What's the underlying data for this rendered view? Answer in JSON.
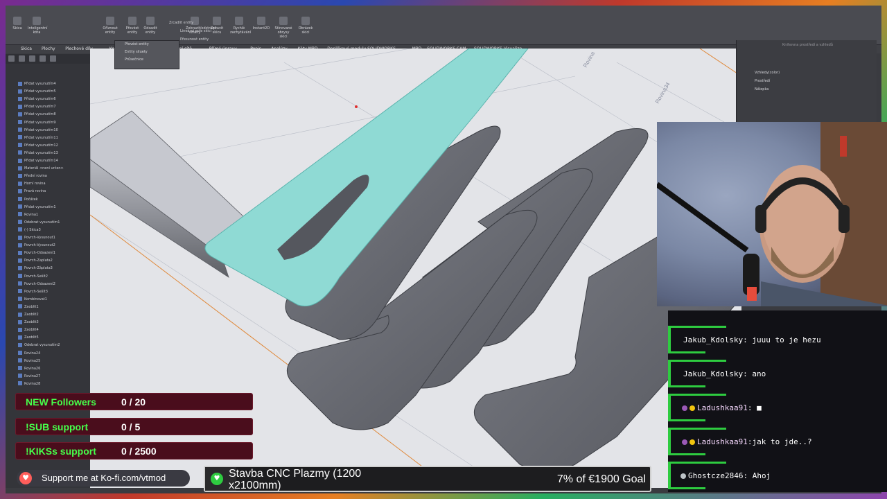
{
  "ribbon": {
    "buttons": [
      "Skica",
      "Inteligentní kóta",
      "Oříznout entity",
      "Převést entity",
      "Odsadit entity",
      "Zobrazit/odstranit vztahy",
      "Opravit skicu",
      "Rychlé zachytávání",
      "Instant2D",
      "Stínované obrysy skici",
      "Obrázek skici"
    ],
    "mirror_label": "Zrcadlit entity",
    "linear_pattern_label": "Lineární pole skici",
    "move_label": "Přesunout entity"
  },
  "dropdown": {
    "items": [
      "Převést entity",
      "Entity siluety",
      "Průsečnice"
    ]
  },
  "command_tabs": [
    "Skica",
    "Plochy",
    "Plechové díly",
    "Konstrukční sys",
    "Modelování sítě",
    "Přímé úpravy",
    "Popis",
    "Analýzy",
    "Kóty MBD",
    "Doplňkové moduly SOLIDWORKS",
    "MBD",
    "SOLIDWORKS CAM",
    "SOLIDWORKS Visualize"
  ],
  "tree": {
    "items": [
      "Přidat vysunutím4",
      "Přidat vysunutím5",
      "Přidat vysunutím6",
      "Přidat vysunutím7",
      "Přidat vysunutím8",
      "Přidat vysunutím9",
      "Přidat vysunutím10",
      "Přidat vysunutím11",
      "Přidat vysunutím12",
      "Přidat vysunutím13",
      "Přidat vysunutím14",
      "Materiál <není určen>",
      "Přední rovina",
      "Horní rovina",
      "Pravá rovina",
      "Počátek",
      "Přidat vysunutím1",
      "Rovina1",
      "Odebrat vysunutím1",
      "(-) Skica3",
      "Povrch-Vysunout1",
      "Povrch-Vysunout2",
      "Povrch-Odsazení1",
      "Povrch-Zaplata2",
      "Povrch-Záplata3",
      "Povrch-Sešít2",
      "Povrch-Odsazení2",
      "Povrch-Sešít3",
      "Kombinovat1",
      "Zaoblit1",
      "Zaoblit2",
      "Zaoblit3",
      "Zaoblit4",
      "Zaoblit5",
      "Odebrat vysunutím2",
      "Rovina24",
      "Rovina25",
      "Rovina26",
      "Rovina27",
      "Rovina28"
    ]
  },
  "viewport": {
    "plane_labels": [
      "Rovina",
      "Rovina34"
    ]
  },
  "taskpane": {
    "title": "Knihovna prostředí a vzhledů",
    "items": [
      "Vzhledy(color)",
      "Prostředí",
      "Nálepka"
    ]
  },
  "chat": {
    "messages": [
      {
        "user": "Jakub_Kdolsky",
        "text": "juuu to je hezu"
      },
      {
        "user": "Jakub_Kdolsky",
        "text": "ano"
      },
      {
        "user": "Ladushkaa91",
        "text": ""
      },
      {
        "user": "Ladushkaa91",
        "text": "jak to jde..?"
      },
      {
        "user": "Ghostcze2846",
        "text": "Ahoj"
      }
    ],
    "colors": {
      "bar": "#2ecc40",
      "username": "#ffffff"
    }
  },
  "goals": [
    {
      "label": "NEW Followers",
      "value": "0 / 20"
    },
    {
      "label": "!SUB support",
      "value": "0 / 5"
    },
    {
      "label": "!KIKSs support",
      "value": "0 / 2500"
    }
  ],
  "kofi": {
    "text": "Support me at Ko-fi.com/vtmod"
  },
  "goal_bar": {
    "title": "Stavba CNC Plazmy (1200 x2100mm)",
    "progress_text": "7% of €1900 Goal",
    "progress": 0.07
  },
  "colors": {
    "accent_green": "#46ff4b",
    "goal_bg": "#4a0d1c",
    "teal_face": "#8fdad4"
  }
}
